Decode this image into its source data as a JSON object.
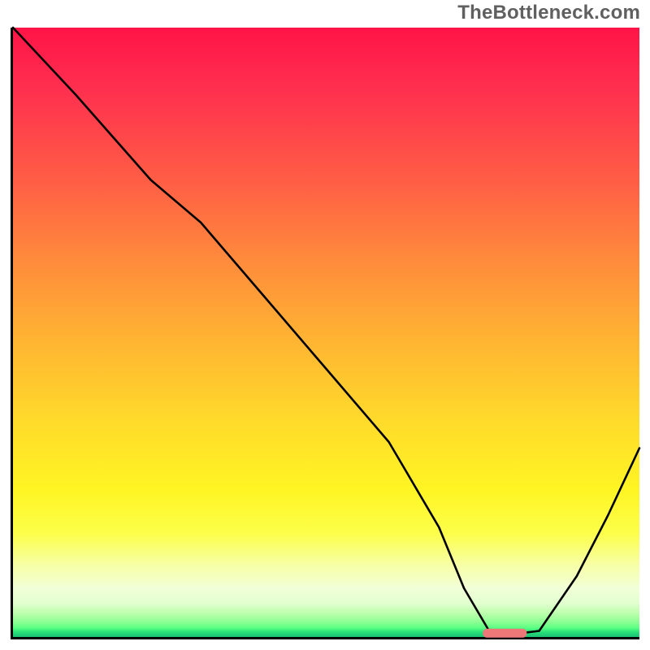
{
  "watermark": "TheBottleneck.com",
  "chart_data": {
    "type": "line",
    "title": "",
    "xlabel": "",
    "ylabel": "",
    "xlim": [
      0,
      100
    ],
    "ylim": [
      0,
      100
    ],
    "gradient_colors": {
      "top": "#ff1447",
      "mid_upper": "#ff8a3c",
      "mid": "#ffdc2a",
      "mid_lower": "#fcff4a",
      "bottom": "#1cbf75"
    },
    "series": [
      {
        "name": "bottleneck-curve",
        "x": [
          0,
          10,
          22,
          30,
          40,
          50,
          60,
          68,
          72,
          76,
          80,
          84,
          90,
          95,
          100
        ],
        "y": [
          100,
          89,
          75,
          68,
          56,
          44,
          32,
          18,
          8,
          1,
          0.5,
          1,
          10,
          20,
          31
        ]
      }
    ],
    "marker": {
      "name": "optimal-range",
      "x_start": 75,
      "x_end": 82,
      "y": 0.7,
      "color": "#ee7878"
    }
  }
}
